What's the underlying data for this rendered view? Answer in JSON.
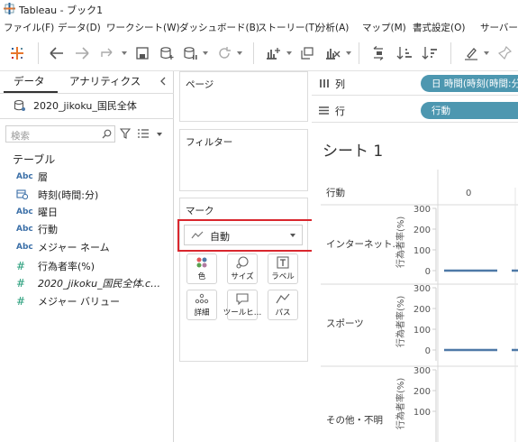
{
  "window": {
    "title": "Tableau - ブック1",
    "logo": "tableau-logo-icon"
  },
  "menu": [
    "ファイル(F)",
    "データ(D)",
    "ワークシート(W)",
    "ダッシュボード(B)",
    "ストーリー(T)",
    "分析(A)",
    "マップ(M)",
    "書式設定(O)",
    "サーバー(S)"
  ],
  "toolbar": {
    "icons": [
      "tableau-home-icon",
      "back-arrow-icon",
      "forward-arrow-icon",
      "redo-icon",
      "save-icon",
      "new-datasource-icon",
      "pause-updates-icon",
      "refresh-icon",
      "new-worksheet-icon",
      "duplicate-sheet-icon",
      "clear-sheet-icon",
      "swap-icon",
      "sort-ascending-icon",
      "sort-descending-icon",
      "highlight-pen-icon",
      "pin-icon",
      "group-icon"
    ]
  },
  "left_pane": {
    "tabs": [
      "データ",
      "アナリティクス"
    ],
    "collapse_icon": "chevron-left-icon",
    "datasource": "2020_jikoku_国民全体",
    "search_placeholder": "検索",
    "section_title": "テーブル",
    "fields": [
      {
        "icon": "Abc",
        "name": "層",
        "type": "dim"
      },
      {
        "icon": "calendar",
        "name": "時刻(時間:分)",
        "type": "dim"
      },
      {
        "icon": "Abc",
        "name": "曜日",
        "type": "dim"
      },
      {
        "icon": "Abc",
        "name": "行動",
        "type": "dim"
      },
      {
        "icon": "Abc",
        "name": "メジャー ネーム",
        "type": "dim"
      },
      {
        "icon": "#",
        "name": "行為者率(%)",
        "type": "meas"
      },
      {
        "icon": "#",
        "name": "2020_jikoku_国民全体.c…",
        "type": "meas"
      },
      {
        "icon": "#",
        "name": "メジャー バリュー",
        "type": "meas"
      }
    ]
  },
  "shelves": {
    "pages": "ページ",
    "filters": "フィルター",
    "marks": "マーク",
    "mark_type": "自動",
    "mark_buttons": [
      "色",
      "サイズ",
      "ラベル",
      "詳細",
      "ツールヒ…",
      "パス"
    ]
  },
  "columns_shelf": {
    "label": "列",
    "pill": "日 時間(時刻(時間:分)"
  },
  "rows_shelf": {
    "label": "行",
    "pill": "行動"
  },
  "viz": {
    "sheet_title": "シート 1",
    "row_header": "行動",
    "column_tick": "0",
    "rows": [
      {
        "label": "インターネット..",
        "axis_title": "行為者率(%)",
        "ticks": [
          "300",
          "200",
          "100",
          "0"
        ]
      },
      {
        "label": "スポーツ",
        "axis_title": "行為者率(%)",
        "ticks": [
          "300",
          "200",
          "100",
          "0"
        ]
      },
      {
        "label": "その他・不明",
        "axis_title": "行為者率(%)",
        "ticks": [
          "300",
          "200",
          "100"
        ]
      }
    ],
    "line_color": "#4e79a7"
  }
}
